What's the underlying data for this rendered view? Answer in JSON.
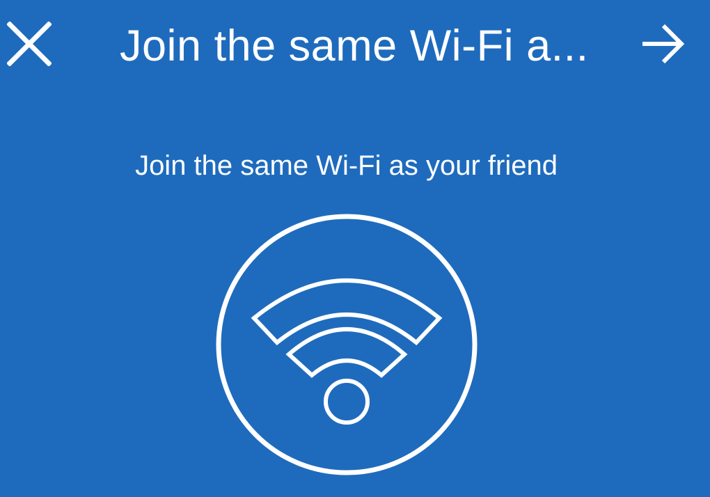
{
  "colors": {
    "background": "#1e6bbd",
    "foreground": "#ffffff"
  },
  "toolbar": {
    "title": "Join the same Wi-Fi a...",
    "close_icon": "close-icon",
    "next_icon": "arrow-right-icon"
  },
  "content": {
    "subtitle": "Join the same Wi-Fi as your friend",
    "illustration_icon": "wifi-icon"
  }
}
